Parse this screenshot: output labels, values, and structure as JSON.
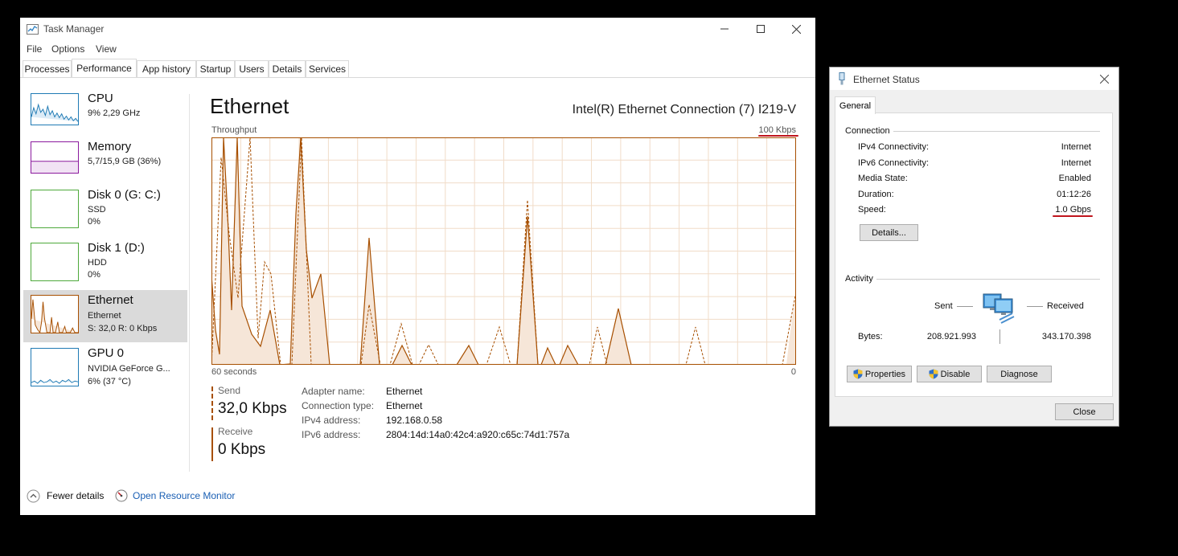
{
  "task_manager": {
    "title": "Task Manager",
    "menu": [
      "File",
      "Options",
      "View"
    ],
    "tabs": [
      "Processes",
      "Performance",
      "App history",
      "Startup",
      "Users",
      "Details",
      "Services"
    ],
    "active_tab": "Performance",
    "sidebar": [
      {
        "name": "CPU",
        "line1": "9%  2,29 GHz",
        "line2": "",
        "color": "#1f7ab4"
      },
      {
        "name": "Memory",
        "line1": "5,7/15,9 GB (36%)",
        "line2": "",
        "color": "#8b1a9e"
      },
      {
        "name": "Disk 0 (G: C:)",
        "line1": "SSD",
        "line2": "0%",
        "color": "#4ea93b"
      },
      {
        "name": "Disk 1 (D:)",
        "line1": "HDD",
        "line2": "0%",
        "color": "#4ea93b"
      },
      {
        "name": "Ethernet",
        "line1": "Ethernet",
        "line2": "S: 32,0  R: 0 Kbps",
        "color": "#a74f00"
      },
      {
        "name": "GPU 0",
        "line1": "NVIDIA GeForce G...",
        "line2": "6% (37 °C)",
        "color": "#1f7ab4"
      }
    ],
    "selected_item": "Ethernet",
    "detail": {
      "title": "Ethernet",
      "adapter": "Intel(R) Ethernet Connection (7) I219-V",
      "graph_label": "Throughput",
      "graph_max": "100 Kbps",
      "graph_left_axis": "60 seconds",
      "graph_right_axis": "0",
      "send_label": "Send",
      "send_value": "32,0 Kbps",
      "receive_label": "Receive",
      "receive_value": "0 Kbps",
      "properties": [
        {
          "key": "Adapter name:",
          "value": "Ethernet"
        },
        {
          "key": "Connection type:",
          "value": "Ethernet"
        },
        {
          "key": "IPv4 address:",
          "value": "192.168.0.58"
        },
        {
          "key": "IPv6 address:",
          "value": "2804:14d:14a0:42c4:a920:c65c:74d1:757a"
        }
      ]
    },
    "footer": {
      "fewer_details": "Fewer details",
      "open_resource_monitor": "Open Resource Monitor"
    },
    "colors": {
      "ethernet": "#a74f00",
      "link": "#1a5fb4"
    }
  },
  "ethernet_status": {
    "title": "Ethernet Status",
    "tab": "General",
    "connection_label": "Connection",
    "connection": [
      {
        "key": "IPv4 Connectivity:",
        "value": "Internet"
      },
      {
        "key": "IPv6 Connectivity:",
        "value": "Internet"
      },
      {
        "key": "Media State:",
        "value": "Enabled"
      },
      {
        "key": "Duration:",
        "value": "01:12:26"
      },
      {
        "key": "Speed:",
        "value": "1.0 Gbps"
      }
    ],
    "details_button": "Details...",
    "activity_label": "Activity",
    "sent_label": "Sent",
    "received_label": "Received",
    "bytes_label": "Bytes:",
    "bytes_sent": "208.921.993",
    "bytes_received": "343.170.398",
    "buttons": [
      "Properties",
      "Disable",
      "Diagnose"
    ],
    "close_button": "Close",
    "annotation_color": "#c0151d"
  }
}
